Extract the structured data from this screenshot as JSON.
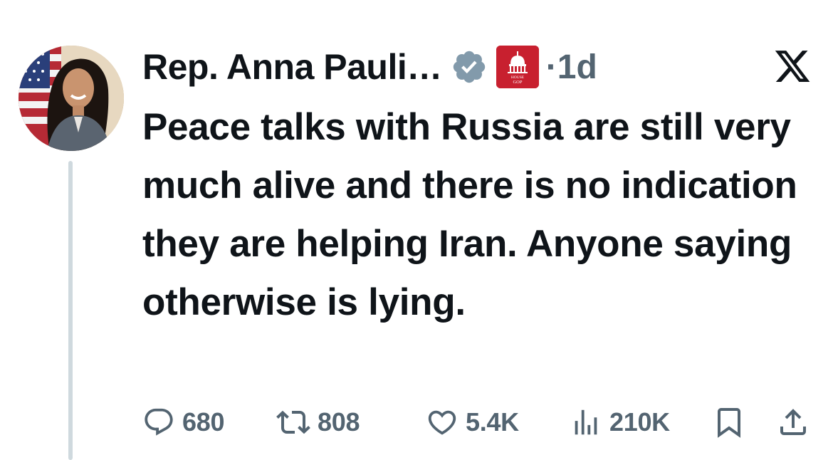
{
  "tweet": {
    "author_name": "Rep. Anna Pauli…",
    "affiliation_badge_text": [
      "HOUSE",
      "GOP"
    ],
    "timestamp": "·1d",
    "text": "Peace talks with Russia are still very much alive and there is no indication they are helping Iran. Anyone saying otherwise is lying.",
    "stats": {
      "replies": "680",
      "retweets": "808",
      "likes": "5.4K",
      "views": "210K"
    }
  },
  "icons": {
    "verified": "verified-badge-icon",
    "affiliation": "house-gop-logo-icon",
    "platform": "x-logo-icon",
    "reply": "reply-icon",
    "retweet": "retweet-icon",
    "like": "heart-icon",
    "views": "views-icon",
    "bookmark": "bookmark-icon",
    "share": "share-icon"
  },
  "colors": {
    "text": "#0f1419",
    "secondary": "#536471",
    "verified_badge": "#829aab",
    "gop_badge": "#c8202f",
    "thread_line": "#cfd9de"
  }
}
